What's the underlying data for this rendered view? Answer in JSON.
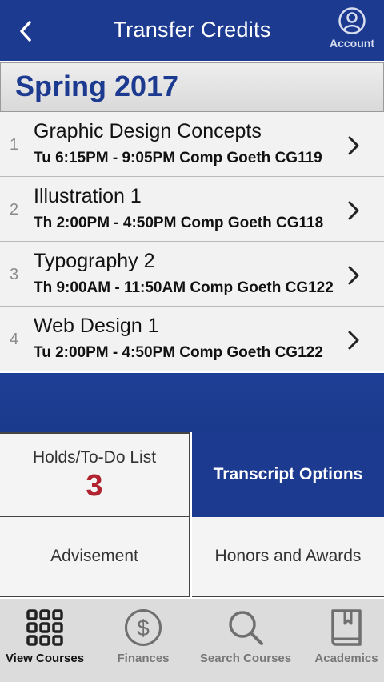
{
  "header": {
    "title": "Transfer Credits",
    "account_label": "Account"
  },
  "term": {
    "label": "Spring 2017"
  },
  "courses": [
    {
      "number": "1",
      "name": "Graphic Design Concepts",
      "schedule": "Tu 6:15PM - 9:05PM Comp Goeth CG119"
    },
    {
      "number": "2",
      "name": "Illustration 1",
      "schedule": "Th 2:00PM - 4:50PM Comp Goeth CG118"
    },
    {
      "number": "3",
      "name": "Typography 2",
      "schedule": "Th 9:00AM - 11:50AM Comp Goeth CG122"
    },
    {
      "number": "4",
      "name": "Web Design 1",
      "schedule": "Tu 2:00PM - 4:50PM Comp Goeth CG122"
    }
  ],
  "tiles": {
    "holds_label": "Holds/To-Do List",
    "holds_count": "3",
    "transcript_label": "Transcript Options",
    "advisement_label": "Advisement",
    "honors_label": "Honors and Awards"
  },
  "tabs": [
    {
      "label": "View Courses",
      "icon": "grid-icon",
      "active": true
    },
    {
      "label": "Finances",
      "icon": "dollar-icon",
      "active": false
    },
    {
      "label": "Search Courses",
      "icon": "search-icon",
      "active": false
    },
    {
      "label": "Academics",
      "icon": "book-icon",
      "active": false
    }
  ],
  "colors": {
    "brand_blue": "#1c3a8f",
    "count_red": "#b0232f",
    "tab_bg": "#dcdcdc"
  }
}
